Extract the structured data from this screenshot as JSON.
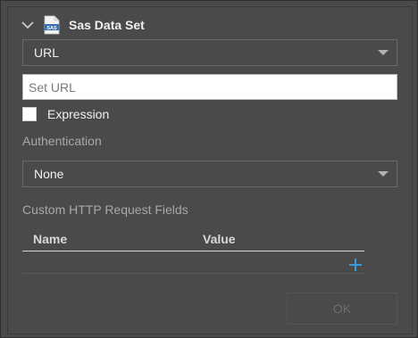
{
  "panel": {
    "title": "Sas Data Set",
    "icon": "sas-file-icon",
    "expand_icon": "chevron-down-icon"
  },
  "source_type": {
    "selected": "URL"
  },
  "url_input": {
    "value": "",
    "placeholder": "Set URL"
  },
  "expression": {
    "label": "Expression",
    "checked": false
  },
  "authentication": {
    "label": "Authentication",
    "selected": "None"
  },
  "custom_fields": {
    "label": "Custom HTTP Request Fields",
    "columns": [
      "Name",
      "Value"
    ],
    "rows": [],
    "add_icon": "plus-icon",
    "add_color": "#3a9ad9"
  },
  "footer": {
    "ok_label": "OK"
  }
}
